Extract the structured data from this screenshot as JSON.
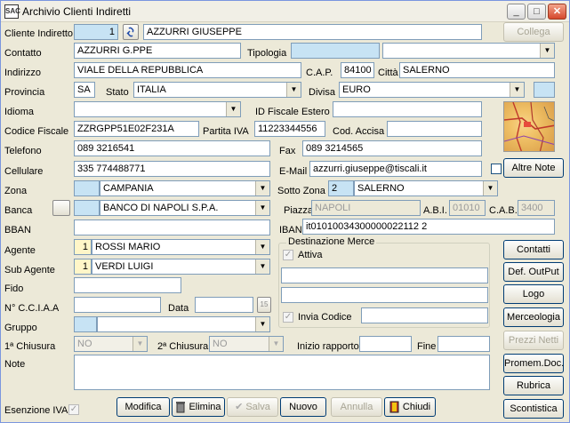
{
  "window": {
    "title": "Archivio Clienti Indiretti",
    "app_icon_text": "SAC",
    "minimize": "_",
    "maximize": "□",
    "close": "✕"
  },
  "labels": {
    "cliente_indiretto": "Cliente Indiretto",
    "contatto": "Contatto",
    "tipologia": "Tipologia",
    "indirizzo": "Indirizzo",
    "cap": "C.A.P.",
    "citta": "Città",
    "provincia": "Provincia",
    "stato": "Stato",
    "divisa": "Divisa",
    "idioma": "Idioma",
    "id_fiscale_estero": "ID Fiscale Estero",
    "codice_fiscale": "Codice Fiscale",
    "partita_iva": "Partita IVA",
    "cod_accisa": "Cod. Accisa",
    "telefono": "Telefono",
    "fax": "Fax",
    "cellulare": "Cellulare",
    "email": "E-Mail",
    "zona": "Zona",
    "sotto_zona": "Sotto Zona",
    "banca": "Banca",
    "piazza": "Piazza",
    "abi": "A.B.I.",
    "cab": "C.A.B.",
    "bban": "BBAN",
    "iban": "IBAN",
    "agente": "Agente",
    "sub_agente": "Sub Agente",
    "destinazione_merce": "Destinazione Merce",
    "attiva": "Attiva",
    "invia_codice": "Invia Codice",
    "fido": "Fido",
    "nr_cciaa": "N° C.C.I.A.A",
    "data": "Data",
    "gruppo": "Gruppo",
    "prima_chiusura": "1ª Chiusura",
    "seconda_chiusura": "2ª Chiusura",
    "inizio_rapporto": "Inizio rapporto",
    "fine": "Fine",
    "note": "Note",
    "esenzione_iva": "Esenzione IVA"
  },
  "values": {
    "cliente_code": "1",
    "cliente_name": "AZZURRI GIUSEPPE",
    "contatto": "AZZURRI G.PPE",
    "tipologia_code": "",
    "tipologia": "",
    "indirizzo": "VIALE DELLA REPUBBLICA",
    "cap": "84100",
    "citta": "SALERNO",
    "provincia": "SA",
    "stato": "ITALIA",
    "divisa": "EURO",
    "idioma": "",
    "id_fiscale_estero": "",
    "codice_fiscale": "ZZRGPP51E02F231A",
    "partita_iva": "11223344556",
    "cod_accisa": "",
    "telefono": "089 3216541",
    "fax": "089 3214565",
    "cellulare": "335 774488771",
    "email": "azzurri.giuseppe@tiscali.it",
    "zona_code": "",
    "zona": "CAMPANIA",
    "sotto_zona_code": "2",
    "sotto_zona": "SALERNO",
    "banca_code": "",
    "banca": "BANCO DI NAPOLI S.P.A.",
    "piazza": "NAPOLI",
    "abi": "01010",
    "cab": "3400",
    "bban": "",
    "iban": "it01010034300000022112 2",
    "agente_code": "1",
    "agente": "ROSSI MARIO",
    "sub_agente_code": "1",
    "sub_agente": "VERDI LUIGI",
    "dest_line1": "",
    "dest_line2": "",
    "invia_codice": "",
    "fido": "",
    "nr_cciaa": "",
    "data": "",
    "data_picker": "15",
    "gruppo_code": "",
    "gruppo": "",
    "prima_chiusura": "NO",
    "seconda_chiusura": "NO",
    "inizio_rapporto": "",
    "fine": "",
    "note": ""
  },
  "buttons": {
    "collega": "Collega",
    "altre_note": "Altre Note",
    "contatti": "Contatti",
    "def_output": "Def. OutPut",
    "logo": "Logo",
    "merceologia": "Merceologia",
    "prezzi_netti": "Prezzi Netti",
    "promem_doc": "Promem.Doc.",
    "rubrica": "Rubrica",
    "scontistica": "Scontistica",
    "modifica": "Modifica",
    "elimina": "Elimina",
    "salva": "Salva",
    "nuovo": "Nuovo",
    "annulla": "Annulla",
    "chiudi": "Chiudi"
  },
  "icons": {
    "link": "link-icon",
    "map": "map-icon",
    "trash": "trash-icon",
    "check": "check-icon",
    "exit": "exit-door-icon"
  }
}
